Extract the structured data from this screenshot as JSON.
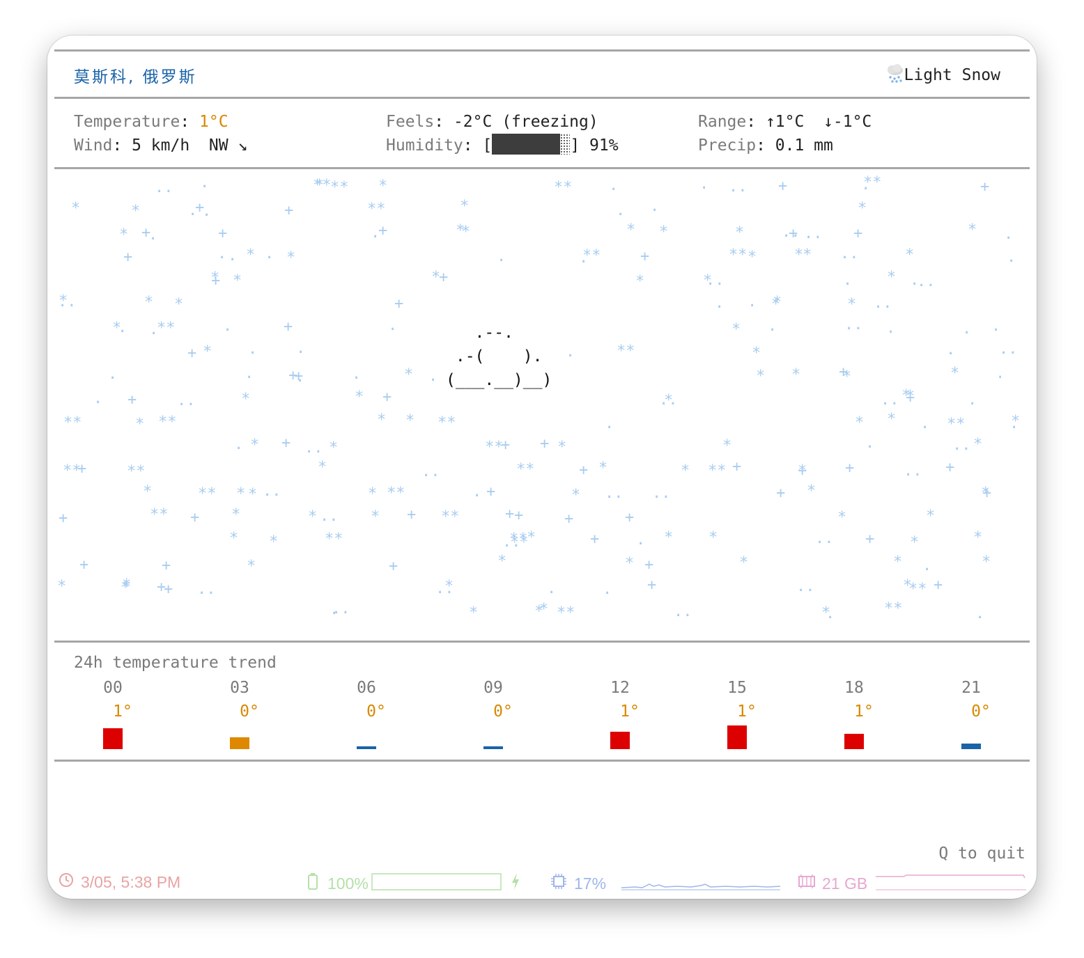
{
  "header": {
    "location": "莫斯科, 俄罗斯",
    "condition_icon": "snow-cloud-icon",
    "condition": "Light Snow"
  },
  "stats": {
    "temperature_label": "Temperature",
    "temperature_value": "1°C",
    "feels_label": "Feels",
    "feels_value": "-2°C (freezing)",
    "range_label": "Range",
    "range_value": "↑1°C  ↓-1°C",
    "wind_label": "Wind",
    "wind_value": "5 km/h  NW ↘",
    "humidity_label": "Humidity",
    "humidity_value": "91%",
    "humidity_fraction": 0.91,
    "precip_label": "Precip",
    "precip_value": "0.1 mm"
  },
  "art": {
    "cloud_lines": [
      "   .--.",
      " .-(    ).",
      "(___.__)__)"
    ]
  },
  "trend": {
    "title": "24h temperature trend",
    "hours": [
      {
        "hour": "00",
        "temp": "1°",
        "value": 1,
        "color": "#dd0000"
      },
      {
        "hour": "03",
        "temp": "0°",
        "value": 0,
        "color": "#dd8800"
      },
      {
        "hour": "06",
        "temp": "0°",
        "value": 0,
        "color": "#1a63a8"
      },
      {
        "hour": "09",
        "temp": "0°",
        "value": 0,
        "color": "#1a63a8"
      },
      {
        "hour": "12",
        "temp": "1°",
        "value": 1,
        "color": "#dd0000"
      },
      {
        "hour": "15",
        "temp": "1°",
        "value": 1,
        "color": "#dd0000"
      },
      {
        "hour": "18",
        "temp": "1°",
        "value": 1,
        "color": "#dd0000"
      },
      {
        "hour": "21",
        "temp": "0°",
        "value": 0,
        "color": "#1a63a8"
      }
    ]
  },
  "footer": {
    "quit_hint": "Q to quit",
    "datetime": "3/05, 5:38 PM",
    "battery": "100%",
    "battery_fraction": 1.0,
    "cpu": "17%",
    "memory": "21 GB",
    "icons": [
      "clock-icon",
      "battery-icon",
      "charging-bolt-icon",
      "cpu-icon",
      "memory-icon"
    ],
    "colors": {
      "clock": "#e9a3a3",
      "battery": "#b5e0a8",
      "cpu": "#9fb6e8",
      "memory": "#e6a8cf"
    }
  }
}
